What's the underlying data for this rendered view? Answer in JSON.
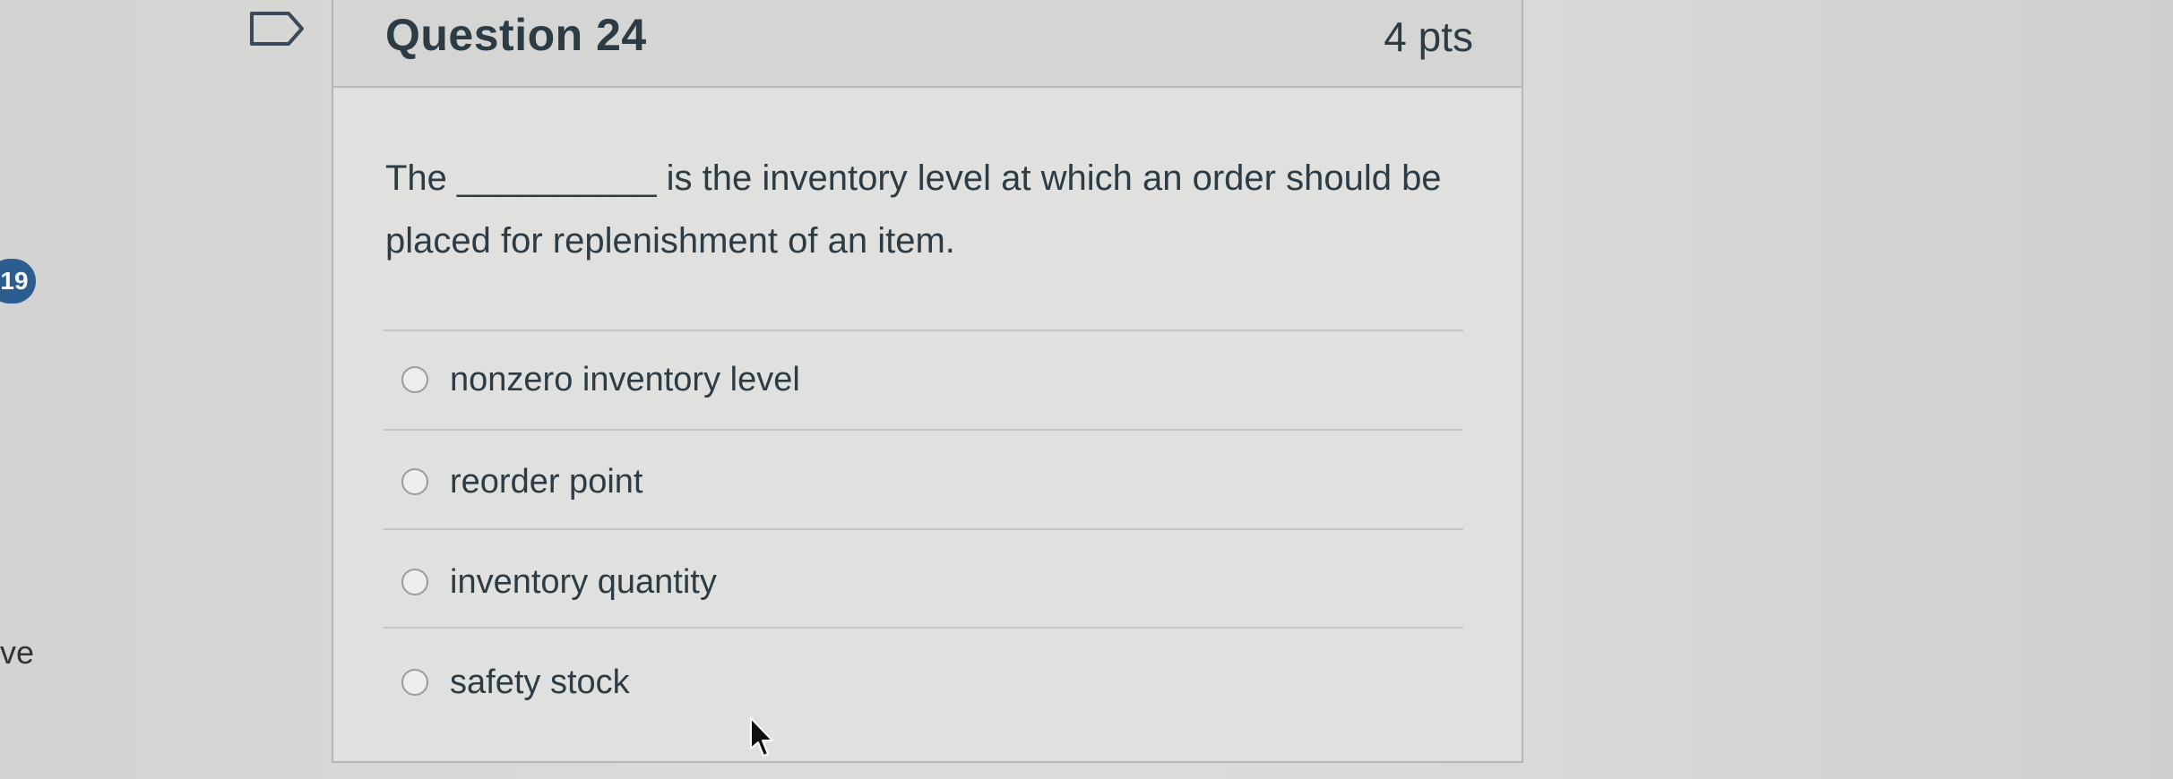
{
  "sidebar": {
    "badge_count": "19",
    "fragment_text": "ve"
  },
  "question": {
    "title": "Question 24",
    "points": "4 pts",
    "prompt": "The __________ is the inventory level at which an order should be placed for replenishment of an item.",
    "answers": [
      {
        "label": "nonzero inventory level",
        "selected": false
      },
      {
        "label": "reorder point",
        "selected": false
      },
      {
        "label": "inventory quantity",
        "selected": false
      },
      {
        "label": "safety stock",
        "selected": false
      }
    ]
  },
  "icons": {
    "flag": "flag-icon",
    "cursor": "mouse-pointer-icon",
    "radio": "radio-button"
  },
  "colors": {
    "badge": "#2b5e8f",
    "text": "#2d3b45",
    "card_background": "#e0e1df",
    "header_background": "#d5d6d4"
  }
}
